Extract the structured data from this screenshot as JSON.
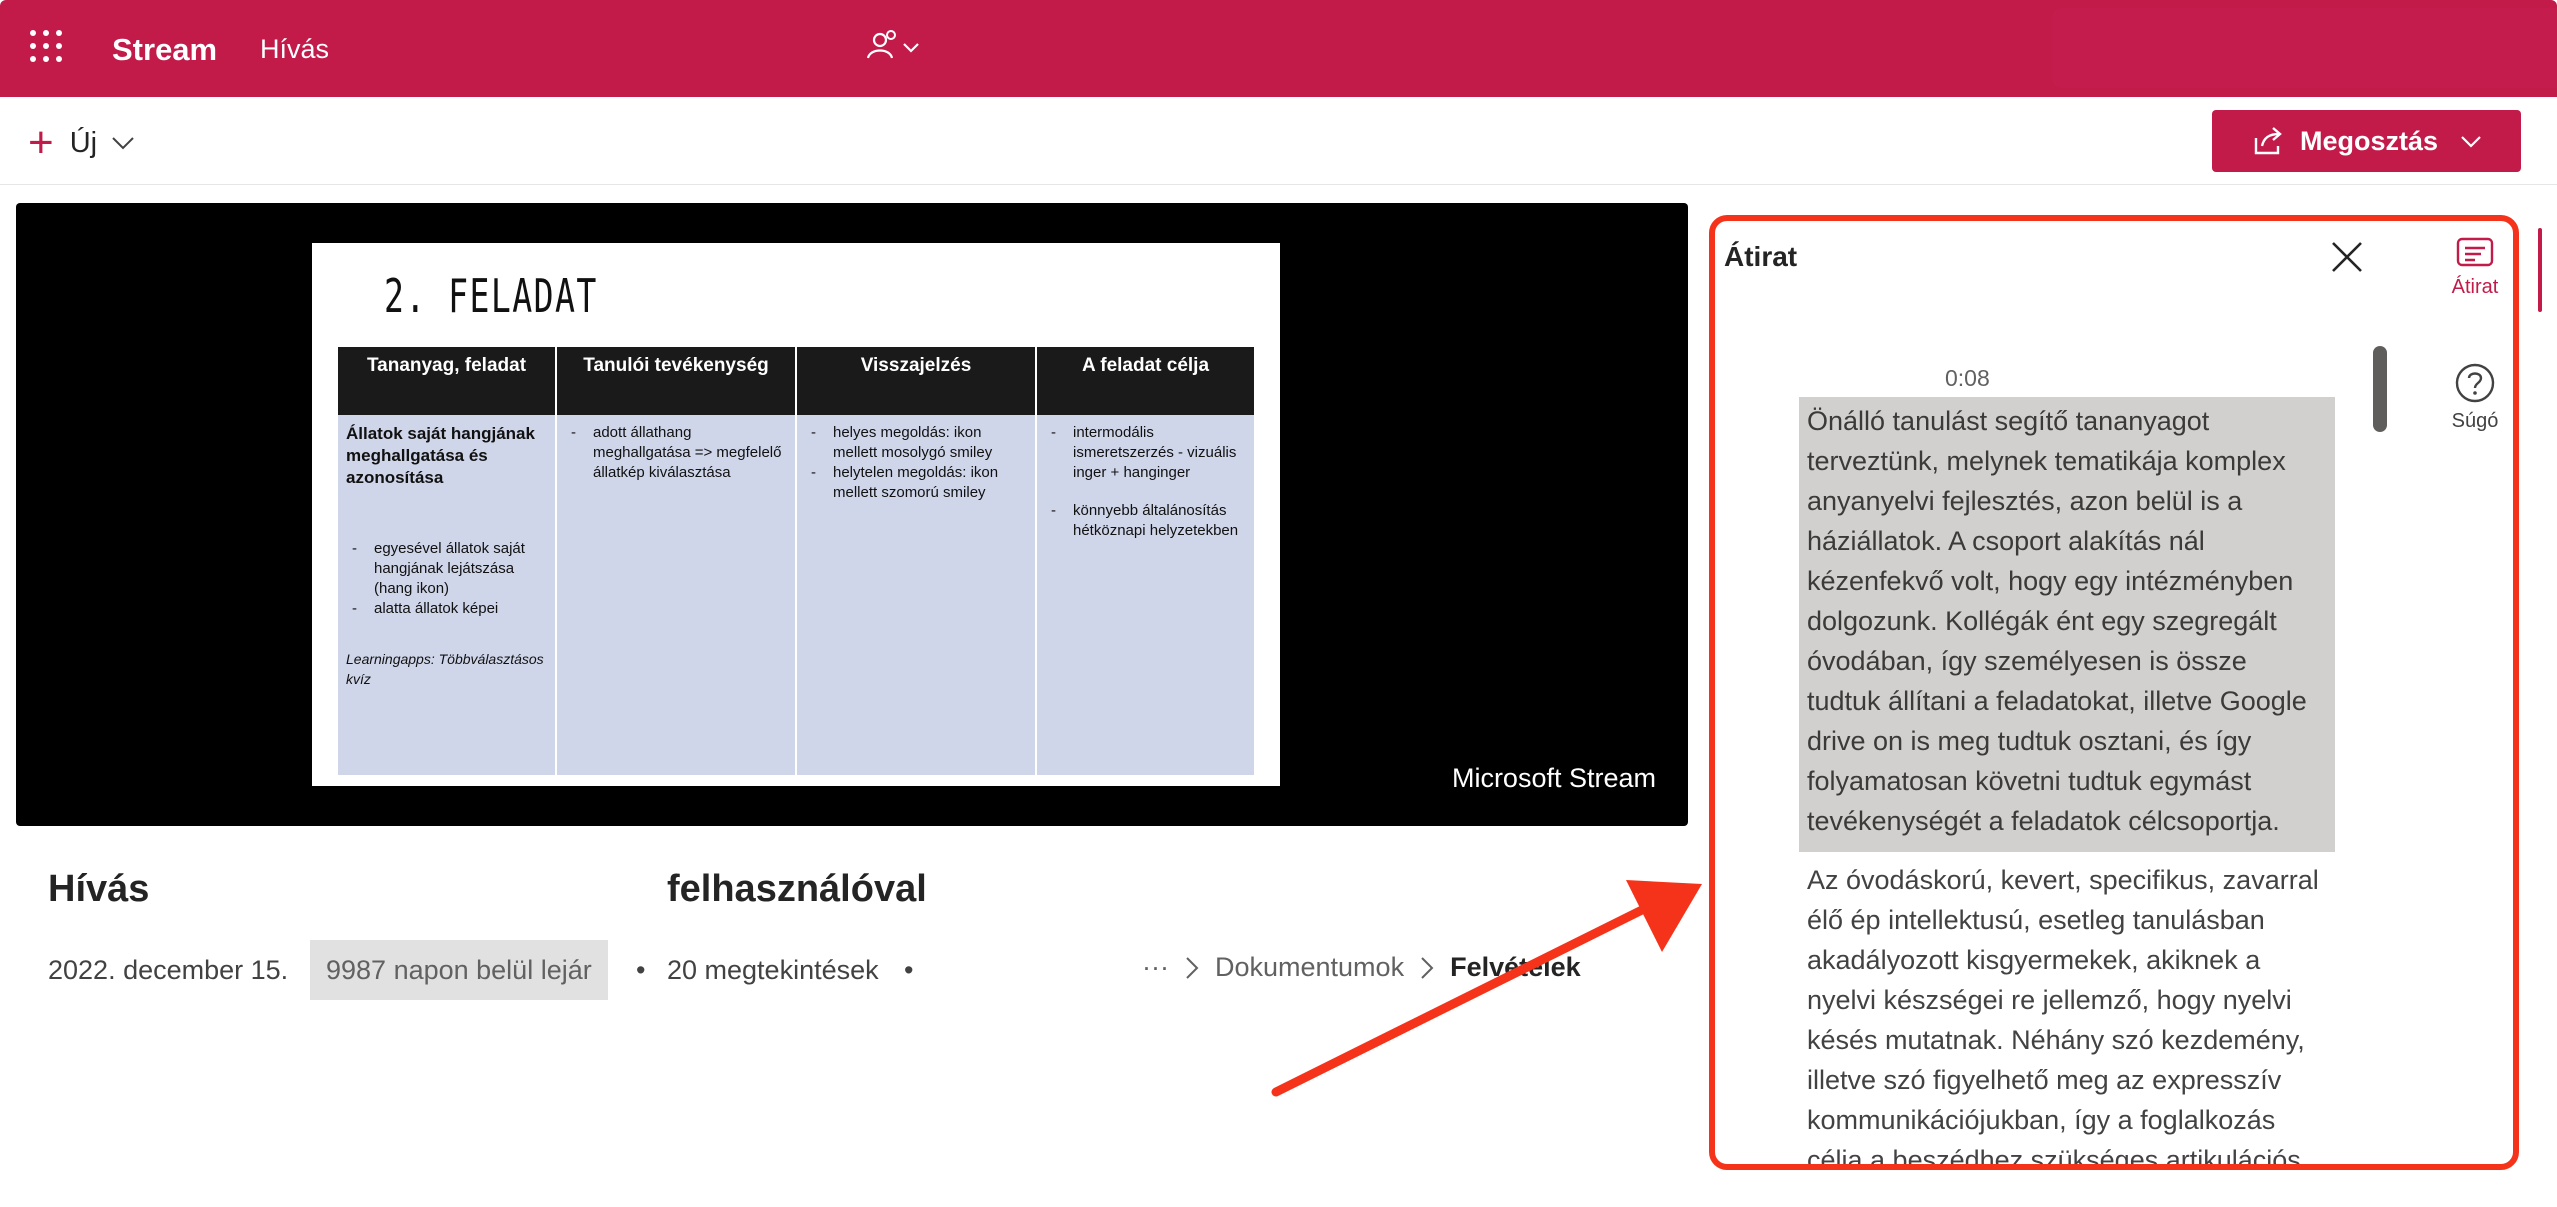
{
  "topbar": {
    "app_name": "Stream",
    "meeting_label": "Hívás",
    "waffle_icon": "app-launcher-icon",
    "people_icon": "participants-icon",
    "accent_color": "#c21b4a"
  },
  "commandbar": {
    "new_label": "Új",
    "share_label": "Megosztás"
  },
  "video": {
    "watermark": "Microsoft Stream",
    "slide": {
      "title": "2. feladat",
      "headers": [
        "Tananyag, feladat",
        "Tanulói tevékenység",
        "Visszajelzés",
        "A feladat célja"
      ],
      "col1_heading": "Állatok saját hangjának meghallgatása és azonosítása",
      "col1_items": [
        "egyesével állatok saját hangjának lejátszása (hang ikon)",
        "alatta állatok képei"
      ],
      "col1_note": "Learningapps: Többválasztásos kvíz",
      "col2_items": [
        "adott állathang meghallgatása => megfelelő állatkép kiválasztása"
      ],
      "col3_items": [
        "helyes megoldás: ikon mellett mosolygó smiley",
        "helytelen megoldás: ikon mellett szomorú smiley"
      ],
      "col4_items": [
        "intermodális ismeretszerzés - vizuális inger + hanginger",
        "könnyebb általánosítás hétköznapi helyzetekben"
      ]
    }
  },
  "info": {
    "title_part1": "Hívás",
    "title_part2": "felhasználóval",
    "date": "2022. december 15.",
    "expiry": "9987 napon belül lejár",
    "views": "20 megtekintések",
    "bullet": "•",
    "breadcrumb": {
      "more": "···",
      "items": [
        "Dokumentumok",
        "Felvételek"
      ]
    }
  },
  "transcript": {
    "title": "Átirat",
    "timestamp": "0:08",
    "active_segment": "Önálló tanulást segítő tananyagot terveztünk, melynek tematikája komplex anyanyelvi fejlesztés, azon belül is a háziállatok. A csoport alakítás nál kézenfekvő volt, hogy egy intézményben dolgozunk. Kollégák ént egy szegregált óvodában, így személyesen is össze tudtuk állítani a feladatokat, illetve Google drive on is meg tudtuk osztani, és így folyamatosan követni tudtuk egymást tevékenységét a feladatok célcsoportja.",
    "next_segment": "Az óvodáskorú, kevert, specifikus, zavarral élő ép intellektusú, esetleg tanulásban akadályozott kisgyermekek, akiknek a nyelvi készségei re jellemző, hogy nyelvi késés mutatnak. Néhány szó kezdemény, illetve szó figyelhető meg az expresszív kommunikációjukban, így a foglalkozás célja a beszédhez szükséges artikulációs bázis megteremtése. A beszéd motoros"
  },
  "rail": {
    "transcript_label": "Átirat",
    "help_label": "Súgó"
  },
  "annotation": {
    "highlight_color": "#f5331b"
  }
}
